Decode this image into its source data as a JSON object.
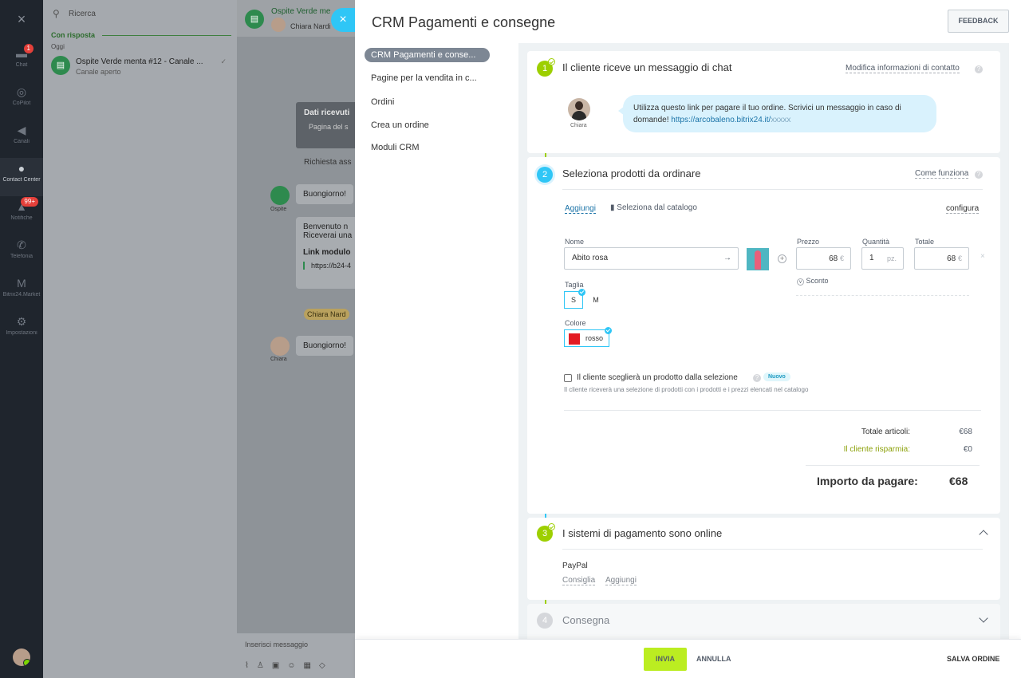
{
  "nav": {
    "items": [
      {
        "label": "Chat",
        "icon": "chat-icon",
        "badge": "1"
      },
      {
        "label": "CoPilot",
        "icon": "copilot-icon"
      },
      {
        "label": "Canali",
        "icon": "megaphone-icon"
      },
      {
        "label": "Contact Center",
        "icon": "contact-center-icon"
      },
      {
        "label": "Notifiche",
        "icon": "bell-icon",
        "badge": "99+"
      },
      {
        "label": "Telefonia",
        "icon": "phone-icon"
      },
      {
        "label": "Bitrix24.Market",
        "icon": "market-icon"
      },
      {
        "label": "Impostazioni",
        "icon": "gear-icon"
      }
    ]
  },
  "chatlist": {
    "search_placeholder": "Ricerca",
    "group_label": "Con risposta",
    "today_label": "Oggi",
    "row_title": "Ospite Verde menta #12 - Canale ...",
    "row_subtitle": "Canale aperto"
  },
  "chat": {
    "title": "Ospite Verde me",
    "subtitle": "Chiara Nardi",
    "sys_title": "Dati ricevuti",
    "sys_sub": "Pagina del s",
    "richiesta": "Richiesta ass",
    "msg1": "Buongiorno!",
    "guest_label": "Ospite",
    "msg2_line1": "Benvenuto n",
    "msg2_line2": "Riceverai una",
    "msg2_link_title": "Link modulo",
    "msg2_link": "https://b24-4",
    "tag": "Chiara Nard",
    "msg3": "Buongiorno!",
    "agent_label": "Chiara",
    "input_placeholder": "Inserisci messaggio"
  },
  "slider": {
    "title": "CRM Pagamenti e consegne",
    "feedback": "FEEDBACK",
    "menu": [
      "CRM Pagamenti e conse...",
      "Pagine per la vendita in c...",
      "Ordini",
      "Crea un ordine",
      "Moduli CRM"
    ],
    "step1": {
      "num": "1",
      "title": "Il cliente riceve un messaggio di chat",
      "link": "Modifica informazioni di contatto",
      "seller": "Chiara",
      "message_line1": "Utilizza questo link per pagare il tuo ordine. Scrivici un messaggio in caso di",
      "message_line2": "domande!",
      "url": "https://arcobaleno.bitrix24.it/",
      "url_tail": "xxxxx"
    },
    "step2": {
      "num": "2",
      "title": "Seleziona prodotti da ordinare",
      "link": "Come funziona",
      "add": "Aggiungi",
      "catalog": "Seleziona dal catalogo",
      "configure": "configura",
      "name_label": "Nome",
      "name_value": "Abito rosa",
      "price_label": "Prezzo",
      "price_value": "68",
      "currency": "€",
      "qty_label": "Quantità",
      "qty_value": "1",
      "qty_unit": "pz.",
      "total_label": "Totale",
      "total_value": "68",
      "discount": "Sconto",
      "size_label": "Taglia",
      "sizes": [
        "S",
        "M"
      ],
      "color_label": "Colore",
      "color_value": "rosso",
      "color_hex": "#e31b23",
      "checkbox_label": "Il cliente sceglierà un prodotto dalla selezione",
      "new_badge": "Nuovo",
      "checkbox_hint": "Il cliente riceverà una selezione di prodotti con i prodotti e i prezzi elencati nel catalogo",
      "items_total_label": "Totale articoli:",
      "items_total_value": "€68",
      "saves_label": "Il cliente risparmia:",
      "saves_value": "€0",
      "pay_label": "Importo da pagare:",
      "pay_value": "€68"
    },
    "step3": {
      "num": "3",
      "title": "I sistemi di pagamento sono online",
      "system": "PayPal",
      "recommend": "Consiglia",
      "add": "Aggiungi"
    },
    "step4": {
      "num": "4",
      "title": "Consegna"
    },
    "footer": {
      "send": "INVIA",
      "cancel": "ANNULLA",
      "save": "SALVA ORDINE"
    }
  },
  "colors": {
    "accent_blue": "#2fc6f6",
    "step_green": "#9dcf00",
    "send_button": "#bbed21"
  }
}
